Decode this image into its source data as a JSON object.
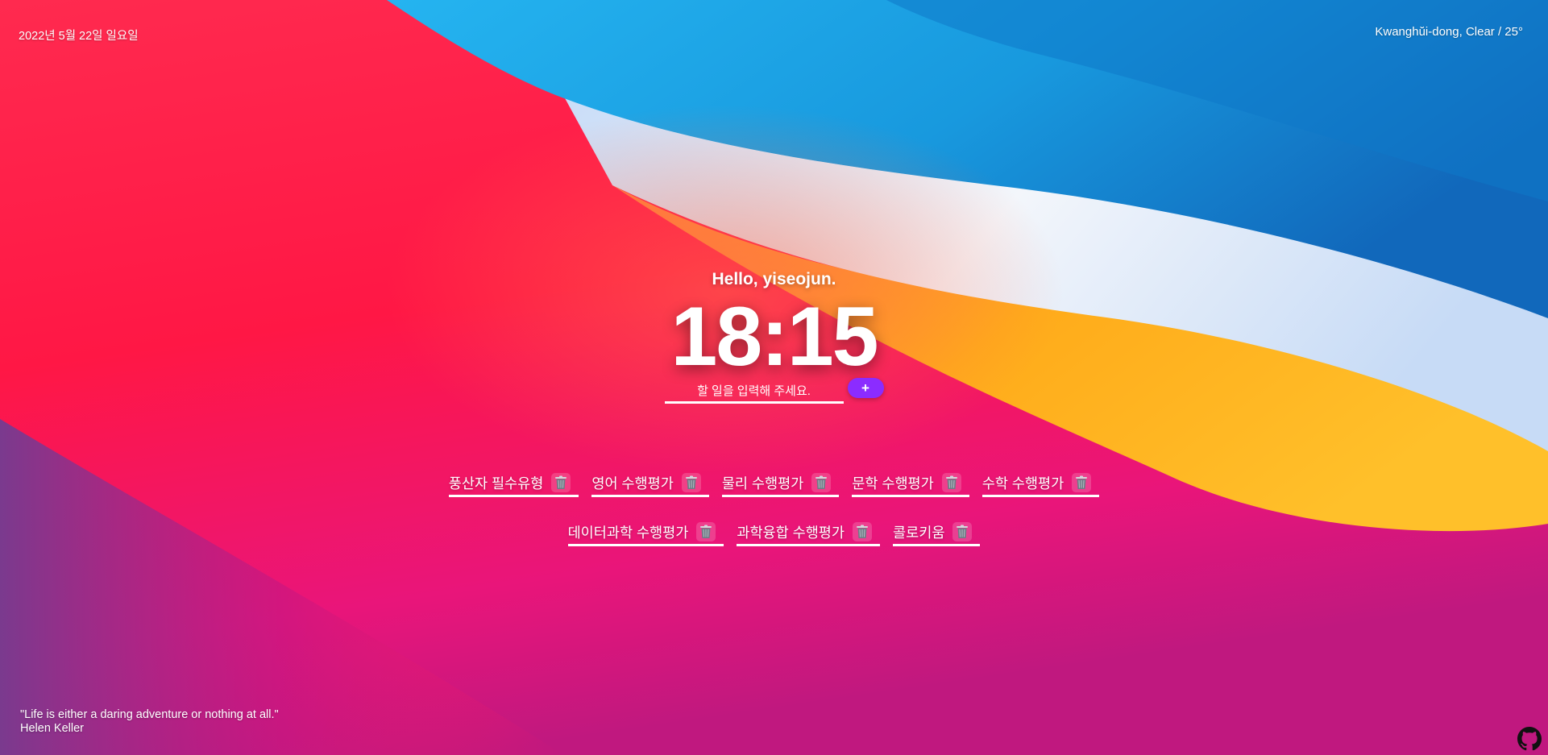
{
  "header": {
    "date": "2022년 5월 22일 일요일",
    "weather": "Kwanghŭi-dong, Clear / 25°"
  },
  "main": {
    "greeting": "Hello, yiseojun.",
    "clock": "18:15",
    "todo_input": {
      "placeholder": "할 일을 입력해 주세요.",
      "value": ""
    },
    "add_button_label": "+"
  },
  "todos": [
    {
      "text": "풍산자 필수유형",
      "delete_icon": "trash-icon"
    },
    {
      "text": "영어 수행평가",
      "delete_icon": "trash-icon"
    },
    {
      "text": "물리 수행평가",
      "delete_icon": "trash-icon"
    },
    {
      "text": "문학 수행평가",
      "delete_icon": "trash-icon"
    },
    {
      "text": "수학 수행평가",
      "delete_icon": "trash-icon"
    },
    {
      "text": "데이터과학 수행평가",
      "delete_icon": "trash-icon"
    },
    {
      "text": "과학융합 수행평가",
      "delete_icon": "trash-icon"
    },
    {
      "text": "콜로키움",
      "delete_icon": "trash-icon"
    }
  ],
  "quote": {
    "text": "\"Life is either a daring adventure or nothing at all.\"",
    "author": "Helen Keller"
  },
  "footer": {
    "github_icon": "github-icon"
  },
  "colors": {
    "accent_button": "#8b2cff",
    "background_red": "#ff1f4b",
    "background_blue": "#1aa6ea",
    "background_orange": "#ffb11a"
  }
}
